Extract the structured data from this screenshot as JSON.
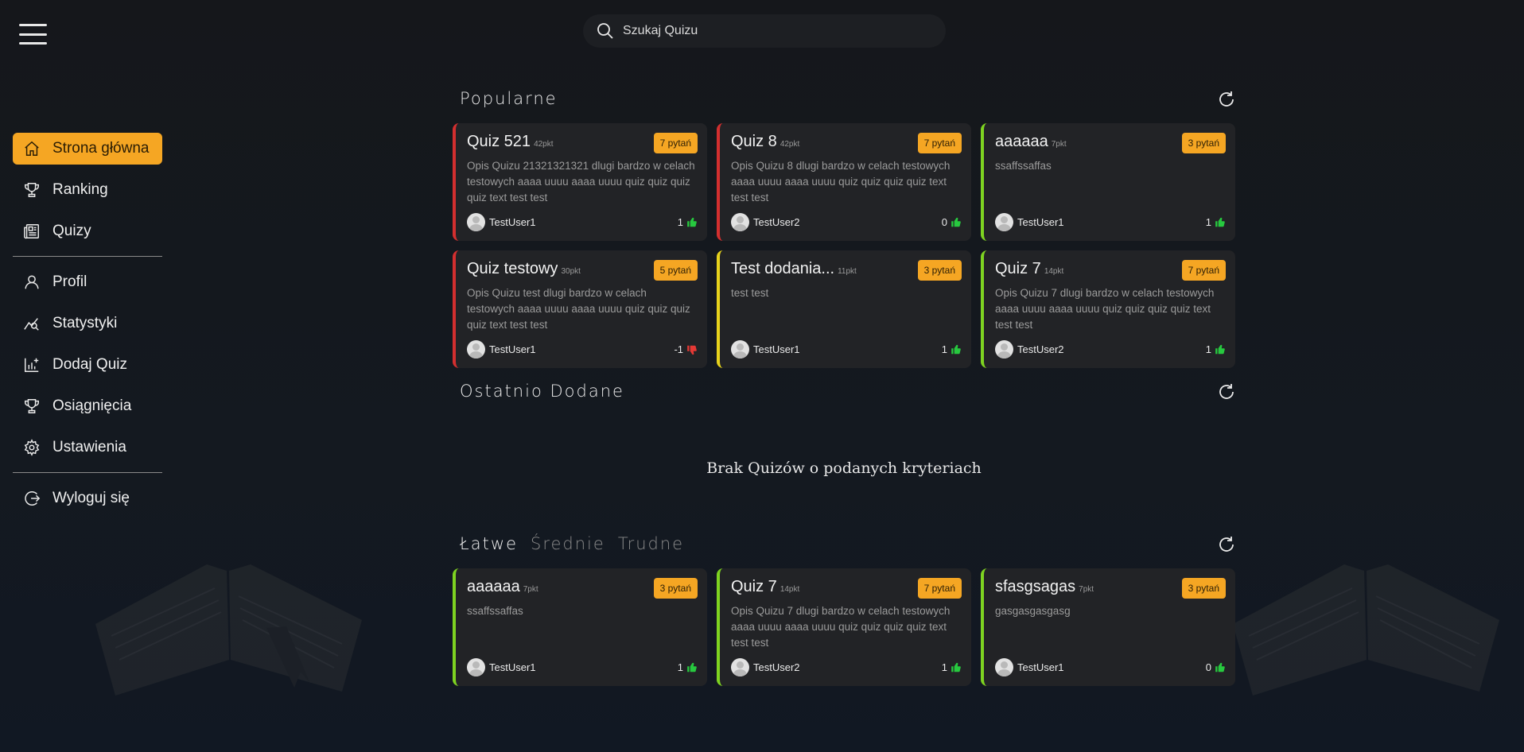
{
  "search": {
    "placeholder": "Szukaj Quizu"
  },
  "sidebar": {
    "items": [
      {
        "label": "Strona główna",
        "icon": "home-icon"
      },
      {
        "label": "Ranking",
        "icon": "trophy-icon"
      },
      {
        "label": "Quizy",
        "icon": "newspaper-icon"
      },
      {
        "label": "Profil",
        "icon": "user-icon"
      },
      {
        "label": "Statystyki",
        "icon": "stats-icon"
      },
      {
        "label": "Dodaj Quiz",
        "icon": "add-chart-icon"
      },
      {
        "label": "Osiągnięcia",
        "icon": "trophy-icon"
      },
      {
        "label": "Ustawienia",
        "icon": "gear-icon"
      },
      {
        "label": "Wyloguj się",
        "icon": "logout-icon"
      }
    ]
  },
  "popular": {
    "title": "Popularne",
    "cards": [
      {
        "title": "Quiz 521",
        "pts": "42pkt",
        "badge": "7 pytań",
        "desc": "Opis Quizu 21321321321 dlugi bardzo w celach testowych aaaa uuuu aaaa uuuu quiz quiz quiz quiz text test test",
        "author": "TestUser1",
        "likes": "1",
        "vote": "up",
        "color": "red"
      },
      {
        "title": "Quiz 8",
        "pts": "42pkt",
        "badge": "7 pytań",
        "desc": "Opis Quizu 8 dlugi bardzo w celach testowych aaaa uuuu aaaa uuuu quiz quiz quiz quiz text test test",
        "author": "TestUser2",
        "likes": "0",
        "vote": "up",
        "color": "red"
      },
      {
        "title": "aaaaaa",
        "pts": "7pkt",
        "badge": "3 pytań",
        "desc": "ssaffssaffas",
        "author": "TestUser1",
        "likes": "1",
        "vote": "up",
        "color": "green"
      },
      {
        "title": "Quiz testowy",
        "pts": "30pkt",
        "badge": "5 pytań",
        "desc": "Opis Quizu test dlugi bardzo w celach testowych aaaa uuuu aaaa uuuu quiz quiz quiz quiz text test test",
        "author": "TestUser1",
        "likes": "-1",
        "vote": "down",
        "color": "red"
      },
      {
        "title": "Test dodania...",
        "pts": "11pkt",
        "badge": "3 pytań",
        "desc": "test test",
        "author": "TestUser1",
        "likes": "1",
        "vote": "up",
        "color": "yellow"
      },
      {
        "title": "Quiz 7",
        "pts": "14pkt",
        "badge": "7 pytań",
        "desc": "Opis Quizu 7 dlugi bardzo w celach testowych aaaa uuuu aaaa uuuu quiz quiz quiz quiz text test test",
        "author": "TestUser2",
        "likes": "1",
        "vote": "up",
        "color": "green"
      }
    ]
  },
  "recent": {
    "title": "Ostatnio Dodane",
    "empty": "Brak Quizów o podanych kryteriach"
  },
  "difficulty": {
    "tabs": [
      "Łatwe",
      "Średnie",
      "Trudne"
    ],
    "cards": [
      {
        "title": "aaaaaa",
        "pts": "7pkt",
        "badge": "3 pytań",
        "desc": "ssaffssaffas",
        "author": "TestUser1",
        "likes": "1",
        "vote": "up",
        "color": "green"
      },
      {
        "title": "Quiz 7",
        "pts": "14pkt",
        "badge": "7 pytań",
        "desc": "Opis Quizu 7 dlugi bardzo w celach testowych aaaa uuuu aaaa uuuu quiz quiz quiz quiz text test test",
        "author": "TestUser2",
        "likes": "1",
        "vote": "up",
        "color": "green"
      },
      {
        "title": "sfasgsagas",
        "pts": "7pkt",
        "badge": "3 pytań",
        "desc": "gasgasgasgasg",
        "author": "TestUser1",
        "likes": "0",
        "vote": "up",
        "color": "green"
      }
    ]
  },
  "colors": {
    "accent": "#f5a623",
    "easy": "#7ed321",
    "medium": "#e6d21c",
    "hard": "#d32f2f",
    "like": "#27c93f",
    "dislike": "#e53935"
  }
}
